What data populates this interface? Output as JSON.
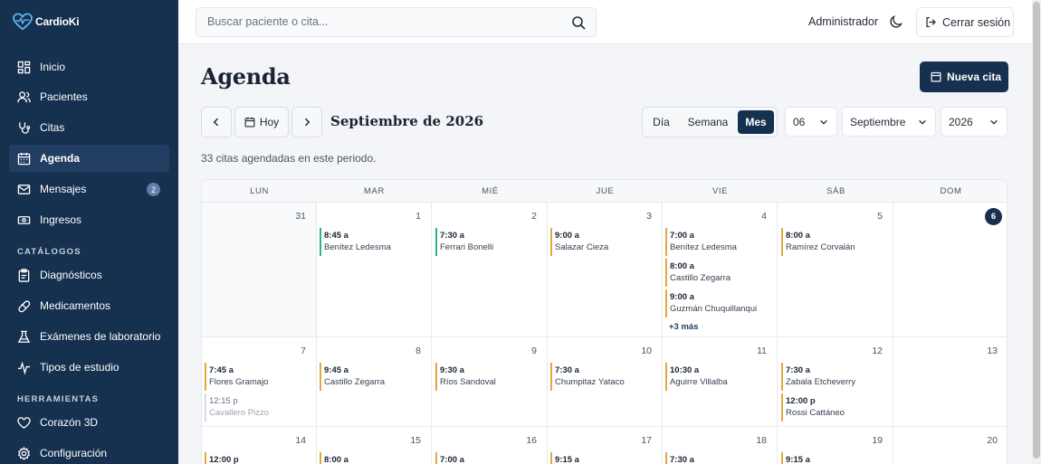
{
  "app": {
    "name": "CardioKi"
  },
  "sidebar": {
    "items": [
      {
        "label": "Inicio",
        "icon": "grid-icon"
      },
      {
        "label": "Pacientes",
        "icon": "users-icon"
      },
      {
        "label": "Citas",
        "icon": "stethoscope-icon"
      },
      {
        "label": "Agenda",
        "icon": "calendar-icon",
        "active": true
      },
      {
        "label": "Mensajes",
        "icon": "mail-icon",
        "badge": "2"
      },
      {
        "label": "Ingresos",
        "icon": "money-icon"
      }
    ],
    "catalogs_label": "CATÁLOGOS",
    "catalogs": [
      {
        "label": "Diagnósticos",
        "icon": "clipboard-icon"
      },
      {
        "label": "Medicamentos",
        "icon": "pill-icon"
      },
      {
        "label": "Exámenes de laboratorio",
        "icon": "flask-icon"
      },
      {
        "label": "Tipos de estudio",
        "icon": "pulse-icon"
      }
    ],
    "tools_label": "HERRAMIENTAS",
    "tools": [
      {
        "label": "Corazón 3D",
        "icon": "heart-icon"
      },
      {
        "label": "Configuración",
        "icon": "settings-icon"
      }
    ]
  },
  "topbar": {
    "search_placeholder": "Buscar paciente o cita...",
    "user": "Administrador",
    "logout": "Cerrar sesión"
  },
  "page": {
    "title": "Agenda",
    "new_button": "Nueva cita",
    "today_button": "Hoy",
    "period": "Septiembre de 2026",
    "views": [
      "Día",
      "Semana",
      "Mes"
    ],
    "active_view": "Mes",
    "day_select": "06",
    "month_select": "Septiembre",
    "year_select": "2026",
    "count_text": "33 citas agendadas en este periodo."
  },
  "calendar": {
    "weekdays": [
      "LUN",
      "MAR",
      "MIÉ",
      "JUE",
      "VIE",
      "SÁB",
      "DOM"
    ],
    "weeks": [
      [
        {
          "day": "31",
          "outside": true,
          "appts": []
        },
        {
          "day": "1",
          "appts": [
            {
              "time": "8:45 a",
              "name": "Benítez Ledesma",
              "color": "green"
            }
          ]
        },
        {
          "day": "2",
          "appts": [
            {
              "time": "7:30 a",
              "name": "Ferrari Bonelli",
              "color": "green"
            }
          ]
        },
        {
          "day": "3",
          "appts": [
            {
              "time": "9:00 a",
              "name": "Salazar Cieza",
              "color": "orange"
            }
          ]
        },
        {
          "day": "4",
          "appts": [
            {
              "time": "7:00 a",
              "name": "Benítez Ledesma",
              "color": "blue"
            },
            {
              "time": "8:00 a",
              "name": "Castillo Zegarra",
              "color": "blue"
            },
            {
              "time": "9:00 a",
              "name": "Guzmán Chuquillanqui",
              "color": "orange"
            }
          ],
          "more": "+3 más"
        },
        {
          "day": "5",
          "appts": [
            {
              "time": "8:00 a",
              "name": "Ramírez Corvalán",
              "color": "orange"
            }
          ]
        },
        {
          "day": "6",
          "today": true,
          "appts": []
        }
      ],
      [
        {
          "day": "7",
          "appts": [
            {
              "time": "7:45 a",
              "name": "Flores Gramajo",
              "color": "orange"
            },
            {
              "time": "12:15 p",
              "name": "Cavallero Pizzo",
              "color": "gray"
            }
          ]
        },
        {
          "day": "8",
          "appts": [
            {
              "time": "9:45 a",
              "name": "Castillo Zegarra",
              "color": "orange"
            }
          ]
        },
        {
          "day": "9",
          "appts": [
            {
              "time": "9:30 a",
              "name": "Ríos Sandoval",
              "color": "orange"
            }
          ]
        },
        {
          "day": "10",
          "appts": [
            {
              "time": "7:30 a",
              "name": "Chumpitaz Yataco",
              "color": "orange"
            }
          ]
        },
        {
          "day": "11",
          "appts": [
            {
              "time": "10:30 a",
              "name": "Aguirre Villalba",
              "color": "orange"
            }
          ]
        },
        {
          "day": "12",
          "appts": [
            {
              "time": "7:30 a",
              "name": "Zabala Etcheverry",
              "color": "orange"
            },
            {
              "time": "12:00 p",
              "name": "Rossi Cattáneo",
              "color": "orange"
            }
          ]
        },
        {
          "day": "13",
          "appts": []
        }
      ],
      [
        {
          "day": "14",
          "appts": [
            {
              "time": "12:00 p",
              "name": "",
              "color": "orange"
            }
          ]
        },
        {
          "day": "15",
          "appts": [
            {
              "time": "8:00 a",
              "name": "",
              "color": "orange"
            }
          ]
        },
        {
          "day": "16",
          "appts": [
            {
              "time": "7:00 a",
              "name": "",
              "color": "orange"
            }
          ]
        },
        {
          "day": "17",
          "appts": [
            {
              "time": "9:15 a",
              "name": "",
              "color": "orange"
            }
          ]
        },
        {
          "day": "18",
          "appts": [
            {
              "time": "7:30 a",
              "name": "",
              "color": "orange"
            }
          ]
        },
        {
          "day": "19",
          "appts": [
            {
              "time": "9:15 a",
              "name": "",
              "color": "orange"
            }
          ]
        },
        {
          "day": "20",
          "appts": []
        }
      ]
    ]
  },
  "colors": {
    "sidebar": "#16304f",
    "accent": "#16304f",
    "orange": "#e2a83a",
    "green": "#2fb47c",
    "gray": "#d8dde5"
  }
}
